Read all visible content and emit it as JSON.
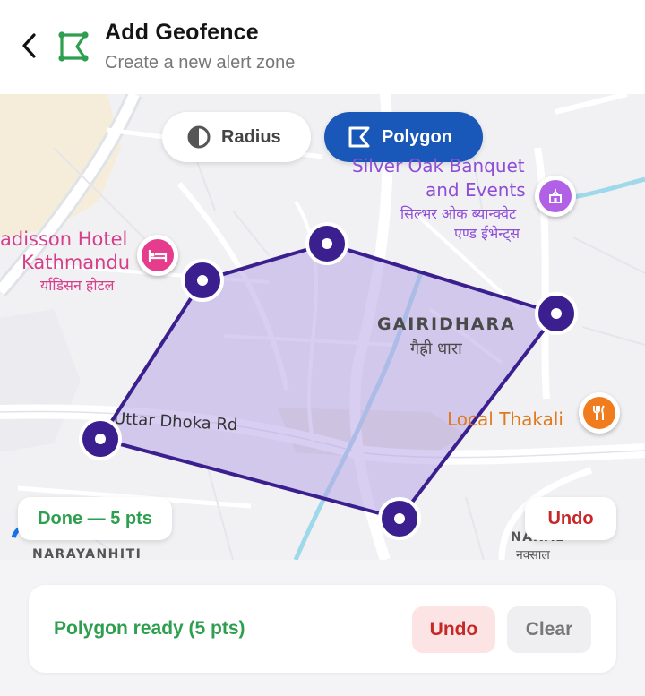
{
  "header": {
    "title": "Add Geofence",
    "subtitle": "Create a new alert zone"
  },
  "mode_toggle": {
    "radius_label": "Radius",
    "polygon_label": "Polygon",
    "selected": "Polygon"
  },
  "map": {
    "labels": {
      "silver_oak_en_1": "Silver Oak Banquet",
      "silver_oak_en_2": "and Events",
      "silver_oak_np_1": "सिल्भर ओक ब्यान्क्वेट",
      "silver_oak_np_2": "एण्ड ईभेन्ट्स",
      "radisson_en_1": "adisson Hotel",
      "radisson_en_2": "Kathmandu",
      "radisson_np": "र्याडिसन होटल",
      "gairidhara_en": "GAIRIDHARA",
      "gairidhara_np": "गैह्री धारा",
      "uttar_dhoka": "Uttar Dhoka Rd",
      "local_thakali": "Local Thakali",
      "narayanhiti": "NARAYANHITI",
      "naxal_en": "NAXAL",
      "naxal_np": "नक्साल"
    },
    "poi_icons": [
      "banquet-icon",
      "hotel-bed-icon",
      "restaurant-icon"
    ],
    "polygon_points": 5,
    "polygon_color": "#3b1f8f",
    "polygon_fill": "#b6a6e6"
  },
  "map_controls": {
    "done_label": "Done — 5 pts",
    "undo_label": "Undo"
  },
  "bottom_panel": {
    "status": "Polygon ready (5 pts)",
    "undo_label": "Undo",
    "clear_label": "Clear"
  },
  "colors": {
    "primary": "#1957b8",
    "success": "#2e9e4f",
    "danger": "#c62828",
    "geofence_logo": "#2e9e4f"
  }
}
